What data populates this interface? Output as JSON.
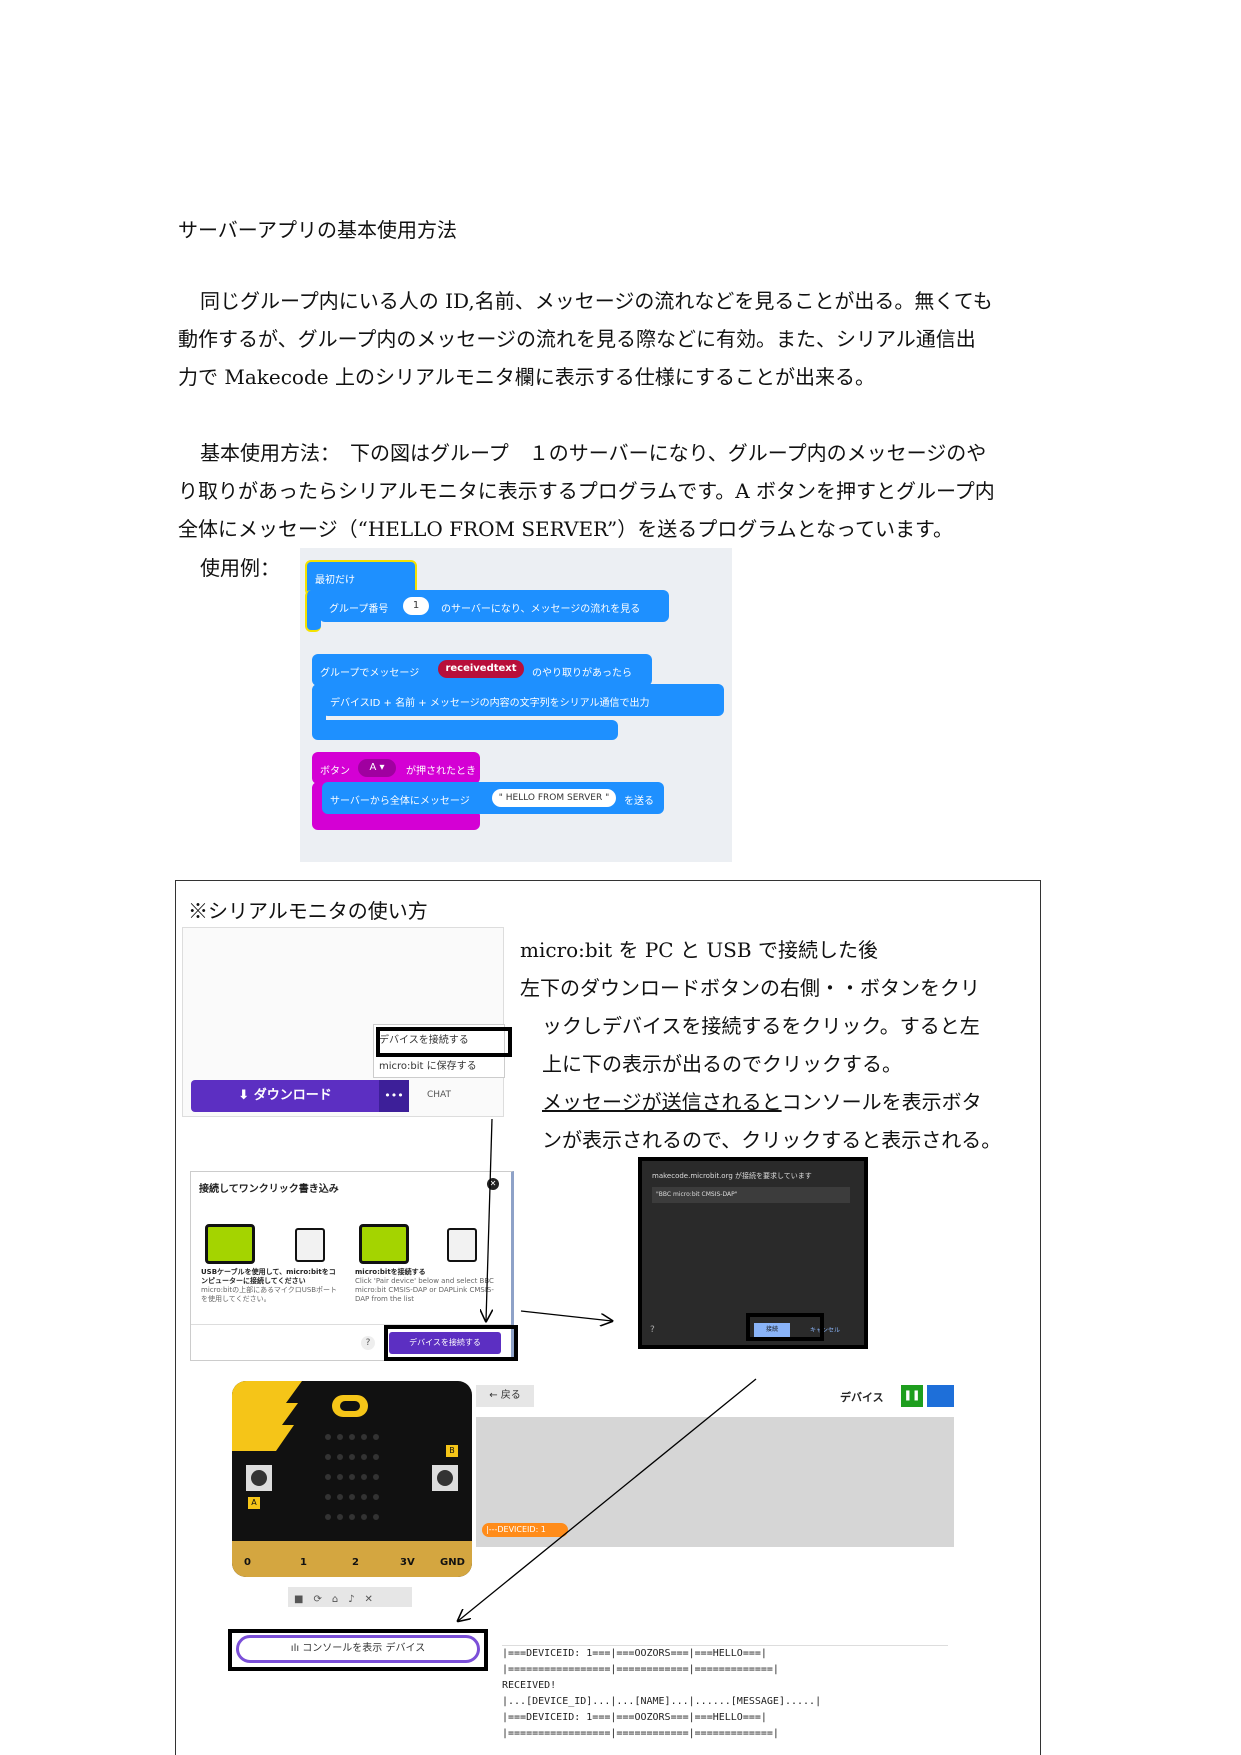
{
  "doc": {
    "heading": "サーバーアプリの基本使用方法",
    "para1_lines": [
      "同じグループ内にいる人の ID,名前、メッセージの流れなどを見ることが出る。無くても",
      "動作するが、グループ内のメッセージの流れを見る際などに有効。また、シリアル通信出",
      "力で Makecode 上のシリアルモニタ欄に表示する仕様にすることが出来る。"
    ],
    "para2_lines": [
      "基本使用方法：　下の図はグループ　１のサーバーになり、グループ内のメッセージのや",
      "り取りがあったらシリアルモニタに表示するプログラムです。A ボタンを押すとグループ内",
      "全体にメッセージ（“HELLO FROM SERVER”）を送るプログラムとなっています。"
    ],
    "example_label": "使用例："
  },
  "blocks": {
    "start_label": "最初だけ",
    "group_label": "グループ番号",
    "group_value": "1",
    "group_suffix": "のサーバーになり、メッセージの流れを見る",
    "onmsg_prefix": "グループでメッセージ",
    "onmsg_var": "receivedtext",
    "onmsg_suffix": "のやり取りがあったら",
    "serial_out": "デバイスID + 名前 + メッセージの内容の文字列をシリアル通信で出力",
    "button_label": "ボタン",
    "button_value": "A ▾",
    "button_suffix": "が押されたとき",
    "send_prefix": "サーバーから全体にメッセージ",
    "send_value": "\" HELLO FROM SERVER \"",
    "send_suffix": "を送る"
  },
  "monitor": {
    "title": "※シリアルモニタの使い方",
    "text_lines": [
      "micro:bit を PC と USB で接続した後",
      "左下のダウンロードボタンの右側・・ボタンをクリ",
      "ックしデバイスを接続するをクリック。すると左",
      "上に下の表示が出るのでクリックする。",
      "メッセージが送信されるとコンソールを表示ボタ",
      "ンが表示されるので、クリックすると表示される。"
    ],
    "underlined": "メッセージが送信されると",
    "menu_connect": "デバイスを接続する",
    "menu_save": "micro:bit に保存する",
    "download_label": "⬇ ダウンロード",
    "more_label": "•••",
    "chat_label": "CHAT",
    "dialog_title": "接続してワンクリック書き込み",
    "step1_title": "USBケーブルを使用して、micro:bitをコンピューターに接続してください",
    "step1_sub": "micro:bitの上部にあるマイクロUSBポートを使用してください。",
    "step2_title": "micro:bitを接続する",
    "step2_sub": "Click 'Pair device' below and select BBC micro:bit CMSIS-DAP or DAPLink CMSIS-DAP from the list",
    "dialog_help": "?",
    "dialog_button": "デバイスを接続する",
    "chrome_title": "makecode.microbit.org が接続を要求しています",
    "chrome_item": "\"BBC micro:bit CMSIS-DAP\"",
    "chrome_connect": "接続",
    "chrome_cancel": "キャンセル",
    "back_label": "← 戻る",
    "device_label": "デバイス",
    "chart_tag": "|---DEVICEID: 1",
    "pins": [
      "0",
      "1",
      "2",
      "3V",
      "GND"
    ],
    "btn_a": "A",
    "btn_b": "B",
    "console_button": "ılı コンソールを表示 デバイス",
    "console_lines": [
      "|===DEVICEID: 1===|===OOZORS===|===HELLO===|",
      "|=================|============|=============|",
      "RECEIVED!",
      "|...[DEVICE_ID]...|...[NAME]...|......[MESSAGE].....|",
      "|===DEVICEID: 1===|===OOZORS===|===HELLO===|",
      "|=================|============|=============|"
    ],
    "colors": {
      "purple": "#5c2fc2",
      "blue": "#1e90ff",
      "magenta": "#d400d4",
      "microbit_yellow": "#f5c518"
    }
  }
}
